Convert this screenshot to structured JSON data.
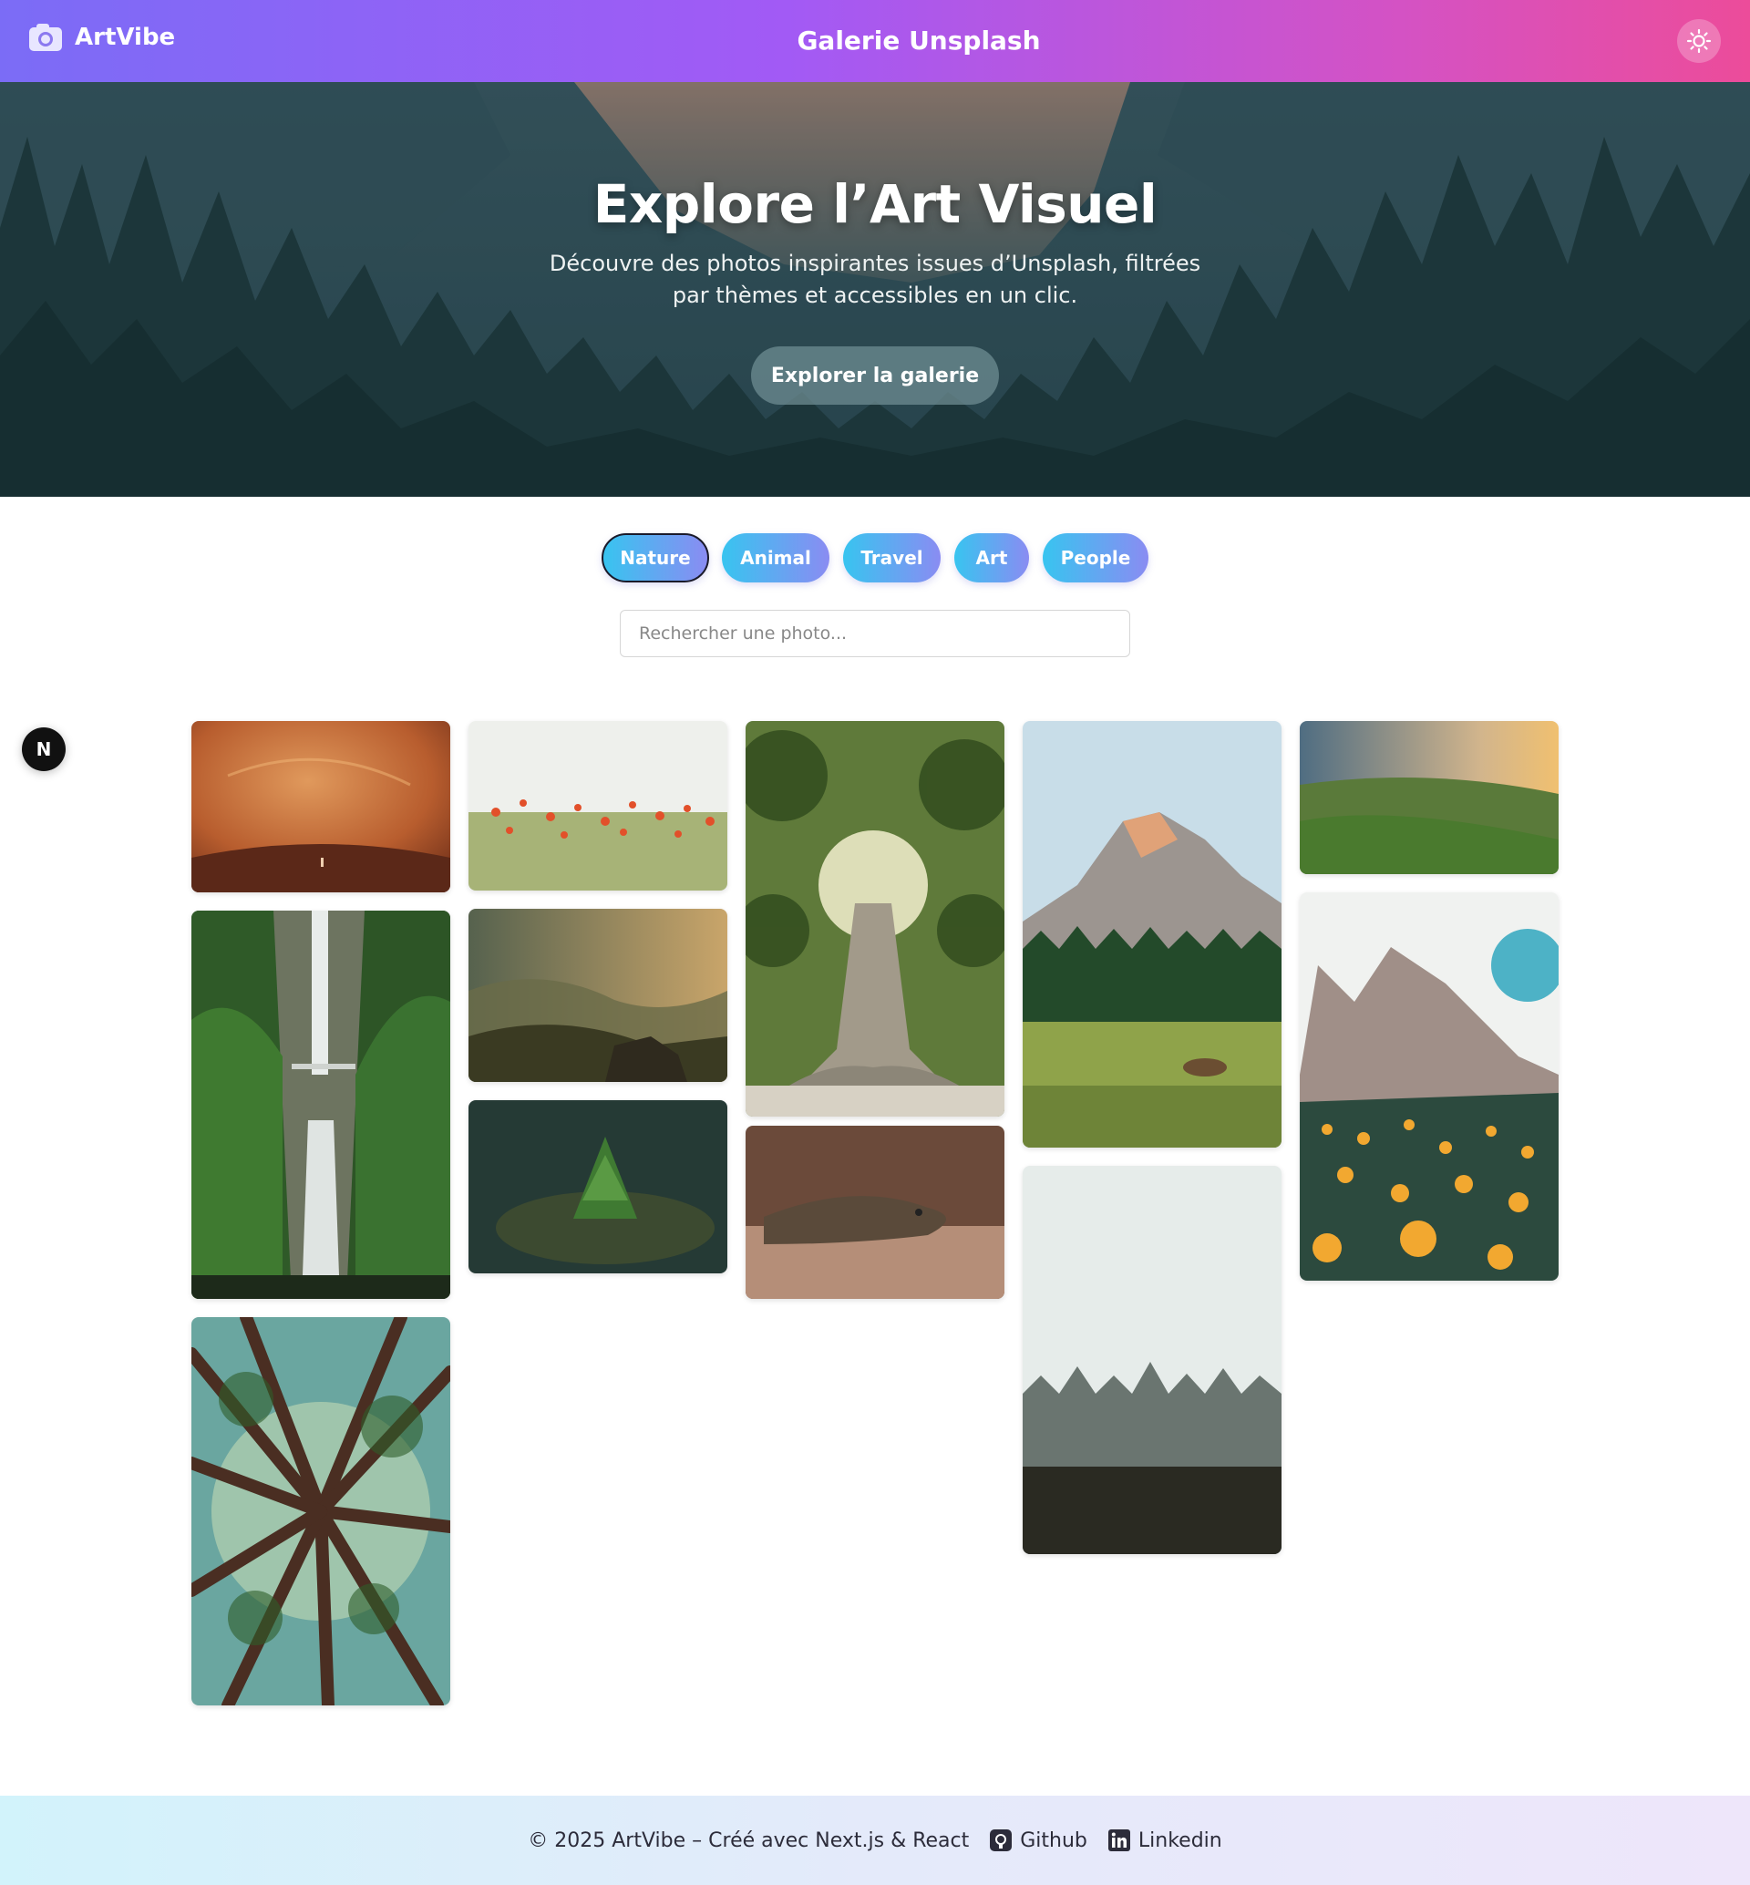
{
  "header": {
    "brand": "ArtVibe",
    "title": "Galerie Unsplash",
    "theme_icon": "sun-icon"
  },
  "hero": {
    "title": "Explore l’Art Visuel",
    "subtitle": "Découvre des photos inspirantes issues d’Unsplash, filtrées par thèmes et accessibles en un clic.",
    "cta": "Explorer la galerie"
  },
  "filters": {
    "items": [
      "Nature",
      "Animal",
      "Travel",
      "Art",
      "People"
    ],
    "active": "Nature"
  },
  "search": {
    "placeholder": "Rechercher une photo..."
  },
  "dev_badge": "N",
  "gallery": {
    "photos": [
      {
        "subject": "orange sandstone cave"
      },
      {
        "subject": "waterfall with bridge"
      },
      {
        "subject": "redwood forest looking up"
      },
      {
        "subject": "red poppy field"
      },
      {
        "subject": "misty mountain valley at sunrise"
      },
      {
        "subject": "small pine tree on moss"
      },
      {
        "subject": "giant banyan tree with sunburst"
      },
      {
        "subject": "lizard on gravel"
      },
      {
        "subject": "Half Dome with deer in meadow"
      },
      {
        "subject": "foggy pine forest"
      },
      {
        "subject": "green hills at sunset"
      },
      {
        "subject": "Dolomites with yellow flowers"
      }
    ]
  },
  "footer": {
    "copyright": "© 2025 ArtVibe – Créé avec Next.js & React",
    "github": "Github",
    "linkedin": "Linkedin"
  },
  "colors": {
    "header_start": "#7b6cf6",
    "header_end": "#ec4c9a",
    "pill_start": "#38c4f0",
    "pill_end": "#8a8cf2"
  }
}
